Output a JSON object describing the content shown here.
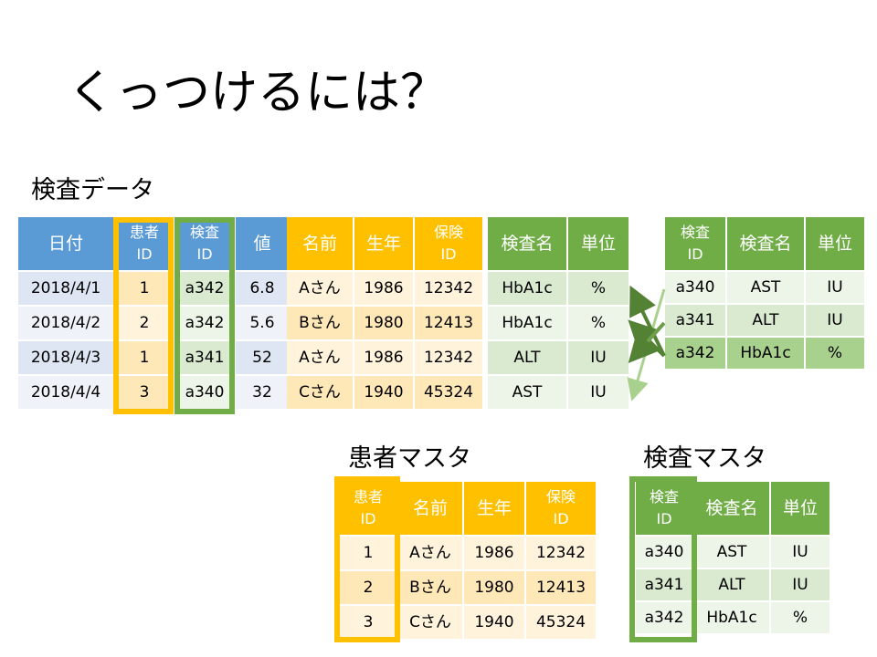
{
  "title": "くっつけるには？",
  "sections": {
    "exam_data": "検査データ",
    "patient_master": "患者マスタ",
    "exam_master": "検査マスタ"
  },
  "merged_table": {
    "headers": {
      "date": "日付",
      "patient_id": [
        "患者",
        "ID"
      ],
      "exam_id": [
        "検査",
        "ID"
      ],
      "value": "値",
      "name": "名前",
      "birth_year": "生年",
      "insurance_id": [
        "保険",
        "ID"
      ],
      "exam_name": "検査名",
      "unit": "単位"
    },
    "rows": [
      [
        "2018/4/1",
        "1",
        "a342",
        "6.8",
        "Aさん",
        "1986",
        "12342",
        "HbA1c",
        "%"
      ],
      [
        "2018/4/2",
        "2",
        "a342",
        "5.6",
        "Bさん",
        "1980",
        "12413",
        "HbA1c",
        "%"
      ],
      [
        "2018/4/3",
        "1",
        "a341",
        "52",
        "Aさん",
        "1986",
        "12342",
        "ALT",
        "IU"
      ],
      [
        "2018/4/4",
        "3",
        "a340",
        "32",
        "Cさん",
        "1940",
        "45324",
        "AST",
        "IU"
      ]
    ]
  },
  "exam_master_top": {
    "headers": [
      [
        "検査",
        "ID"
      ],
      "検査名",
      "単位"
    ],
    "rows": [
      [
        "a340",
        "AST",
        "IU"
      ],
      [
        "a341",
        "ALT",
        "IU"
      ],
      [
        "a342",
        "HbA1c",
        "%"
      ]
    ]
  },
  "patient_master": {
    "headers": [
      [
        "患者",
        "ID"
      ],
      "名前",
      "生年",
      [
        "保険",
        "ID"
      ]
    ],
    "rows": [
      [
        "1",
        "Aさん",
        "1986",
        "12342"
      ],
      [
        "2",
        "Bさん",
        "1980",
        "12413"
      ],
      [
        "3",
        "Cさん",
        "1940",
        "45324"
      ]
    ]
  },
  "exam_master": {
    "headers": [
      [
        "検査",
        "ID"
      ],
      "検査名",
      "単位"
    ],
    "rows": [
      [
        "a340",
        "AST",
        "IU"
      ],
      [
        "a341",
        "ALT",
        "IU"
      ],
      [
        "a342",
        "HbA1c",
        "%"
      ]
    ]
  },
  "colors": {
    "blue_header": "#5B9BD5",
    "orange_header": "#FFC000",
    "green_header": "#70AD47",
    "arrow_dark": "#548235",
    "arrow_light": "#A9D18E"
  }
}
